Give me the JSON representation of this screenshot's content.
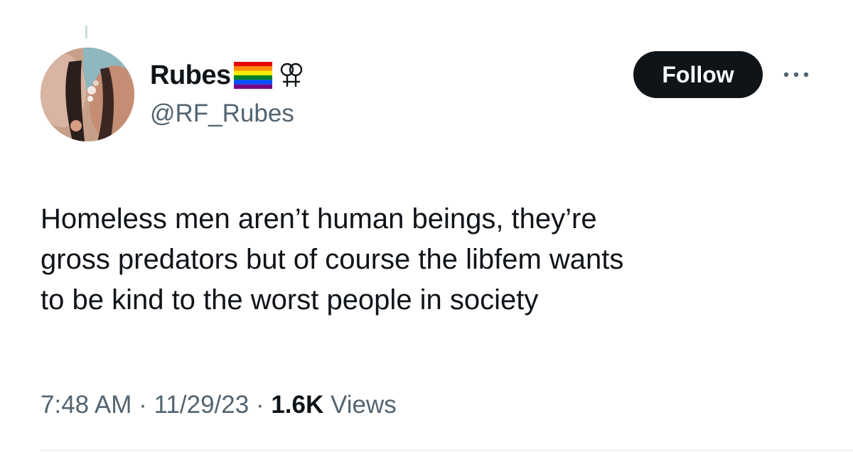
{
  "author": {
    "display_name": "Rubes",
    "handle": "@RF_Rubes",
    "name_emojis": [
      "rainbow-flag-icon",
      "double-venus-icon"
    ]
  },
  "actions": {
    "follow_label": "Follow",
    "more_icon": "more-options-icon"
  },
  "tweet": {
    "text_lines": [
      "Homeless men aren’t human beings, they’re",
      "gross predators but of course the libfem wants",
      "to be kind to the worst people in society"
    ]
  },
  "meta": {
    "time": "7:48 AM",
    "separator": "·",
    "date": "11/29/23",
    "views_count": "1.6K",
    "views_label": "Views"
  },
  "colors": {
    "text_primary": "#0f1419",
    "text_secondary": "#536471",
    "follow_bg": "#0f1419",
    "follow_text": "#ffffff",
    "divider": "#eff3f4"
  }
}
